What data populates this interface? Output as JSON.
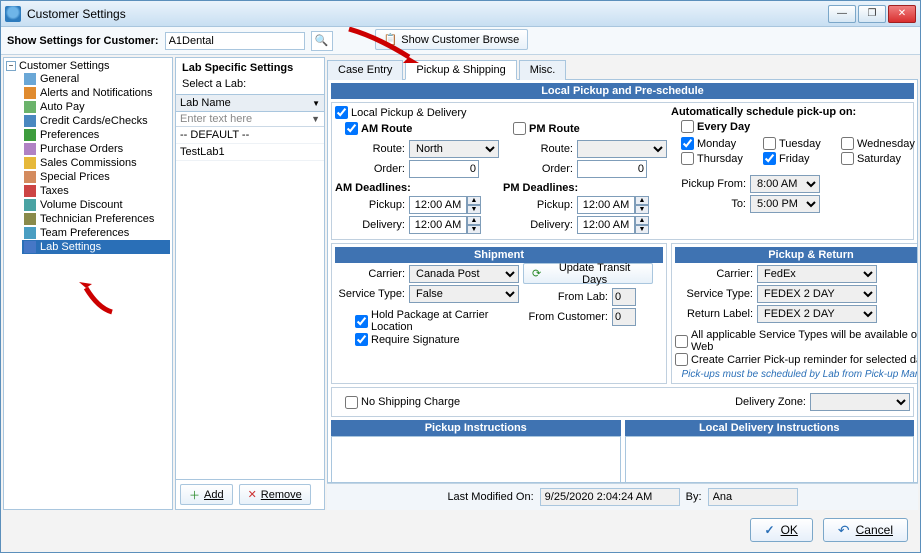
{
  "window": {
    "title": "Customer Settings"
  },
  "toolbar": {
    "label": "Show Settings for Customer:",
    "customer": "A1Dental",
    "browse_btn": "Show Customer Browse"
  },
  "tree": {
    "root": "Customer Settings",
    "items": [
      "General",
      "Alerts and Notifications",
      "Auto Pay",
      "Credit Cards/eChecks",
      "Preferences",
      "Purchase Orders",
      "Sales Commissions",
      "Special Prices",
      "Taxes",
      "Volume Discount",
      "Technician Preferences",
      "Team Preferences",
      "Lab Settings"
    ],
    "selected": 12
  },
  "lab_pane": {
    "title": "Lab Specific Settings",
    "subtitle": "Select a Lab:",
    "column": "Lab Name",
    "filter_placeholder": "Enter text here",
    "rows": [
      "-- DEFAULT --",
      "TestLab1"
    ],
    "add_btn": "Add",
    "remove_btn": "Remove"
  },
  "tabs": {
    "items": [
      "Case Entry",
      "Pickup & Shipping",
      "Misc."
    ],
    "active": 1
  },
  "pickup_section": {
    "head": "Local Pickup and Pre-schedule",
    "local_cb": "Local Pickup & Delivery",
    "am_route": "AM Route",
    "pm_route": "PM Route",
    "route_lbl": "Route:",
    "order_lbl": "Order:",
    "am_route_val": "North",
    "am_order_val": "0",
    "pm_route_val": "",
    "pm_order_val": "0",
    "am_dead": "AM Deadlines:",
    "pm_dead": "PM Deadlines:",
    "pickup_lbl": "Pickup:",
    "delivery_lbl": "Delivery:",
    "am_pickup": "12:00 AM",
    "am_delivery": "12:00 AM",
    "pm_pickup": "12:00 AM",
    "pm_delivery": "12:00 AM",
    "auto_head": "Automatically schedule pick-up on:",
    "every_day": "Every Day",
    "days": [
      "Monday",
      "Tuesday",
      "Wednesday",
      "Thursday",
      "Friday",
      "Saturday"
    ],
    "days_checked": [
      true,
      false,
      false,
      false,
      true,
      false
    ],
    "pickup_from_lbl": "Pickup From:",
    "to_lbl": "To:",
    "pickup_from": "8:00 AM",
    "pickup_to": "5:00 PM"
  },
  "shipment": {
    "head": "Shipment",
    "carrier_lbl": "Carrier:",
    "carrier": "Canada Post",
    "service_lbl": "Service Type:",
    "service": "False",
    "update_btn": "Update Transit Days",
    "from_lab_lbl": "From Lab:",
    "from_lab": "0",
    "from_cust_lbl": "From Customer:",
    "from_cust": "0",
    "hold_cb": "Hold Package at Carrier Location",
    "sig_cb": "Require Signature"
  },
  "pickup_return": {
    "head": "Pickup & Return",
    "carrier_lbl": "Carrier:",
    "carrier": "FedEx",
    "service_lbl": "Service Type:",
    "service": "FEDEX 2 DAY",
    "return_lbl": "Return Label:",
    "return": "FEDEX 2 DAY",
    "web_cb": "All applicable Service Types will be available on the Web",
    "reminder_cb": "Create Carrier Pick-up reminder for selected days",
    "note": "Pick-ups must be scheduled by Lab from Pick-up Manager"
  },
  "shipping_charge": {
    "no_charge": "No Shipping Charge",
    "zone_lbl": "Delivery Zone:",
    "zone": ""
  },
  "instructions": {
    "pickup_head": "Pickup Instructions",
    "delivery_head": "Local Delivery Instructions"
  },
  "footer": {
    "modified_lbl": "Last Modified On:",
    "modified_val": "9/25/2020 2:04:24 AM",
    "by_lbl": "By:",
    "by_val": "Ana"
  },
  "buttons": {
    "ok": "OK",
    "cancel": "Cancel"
  }
}
